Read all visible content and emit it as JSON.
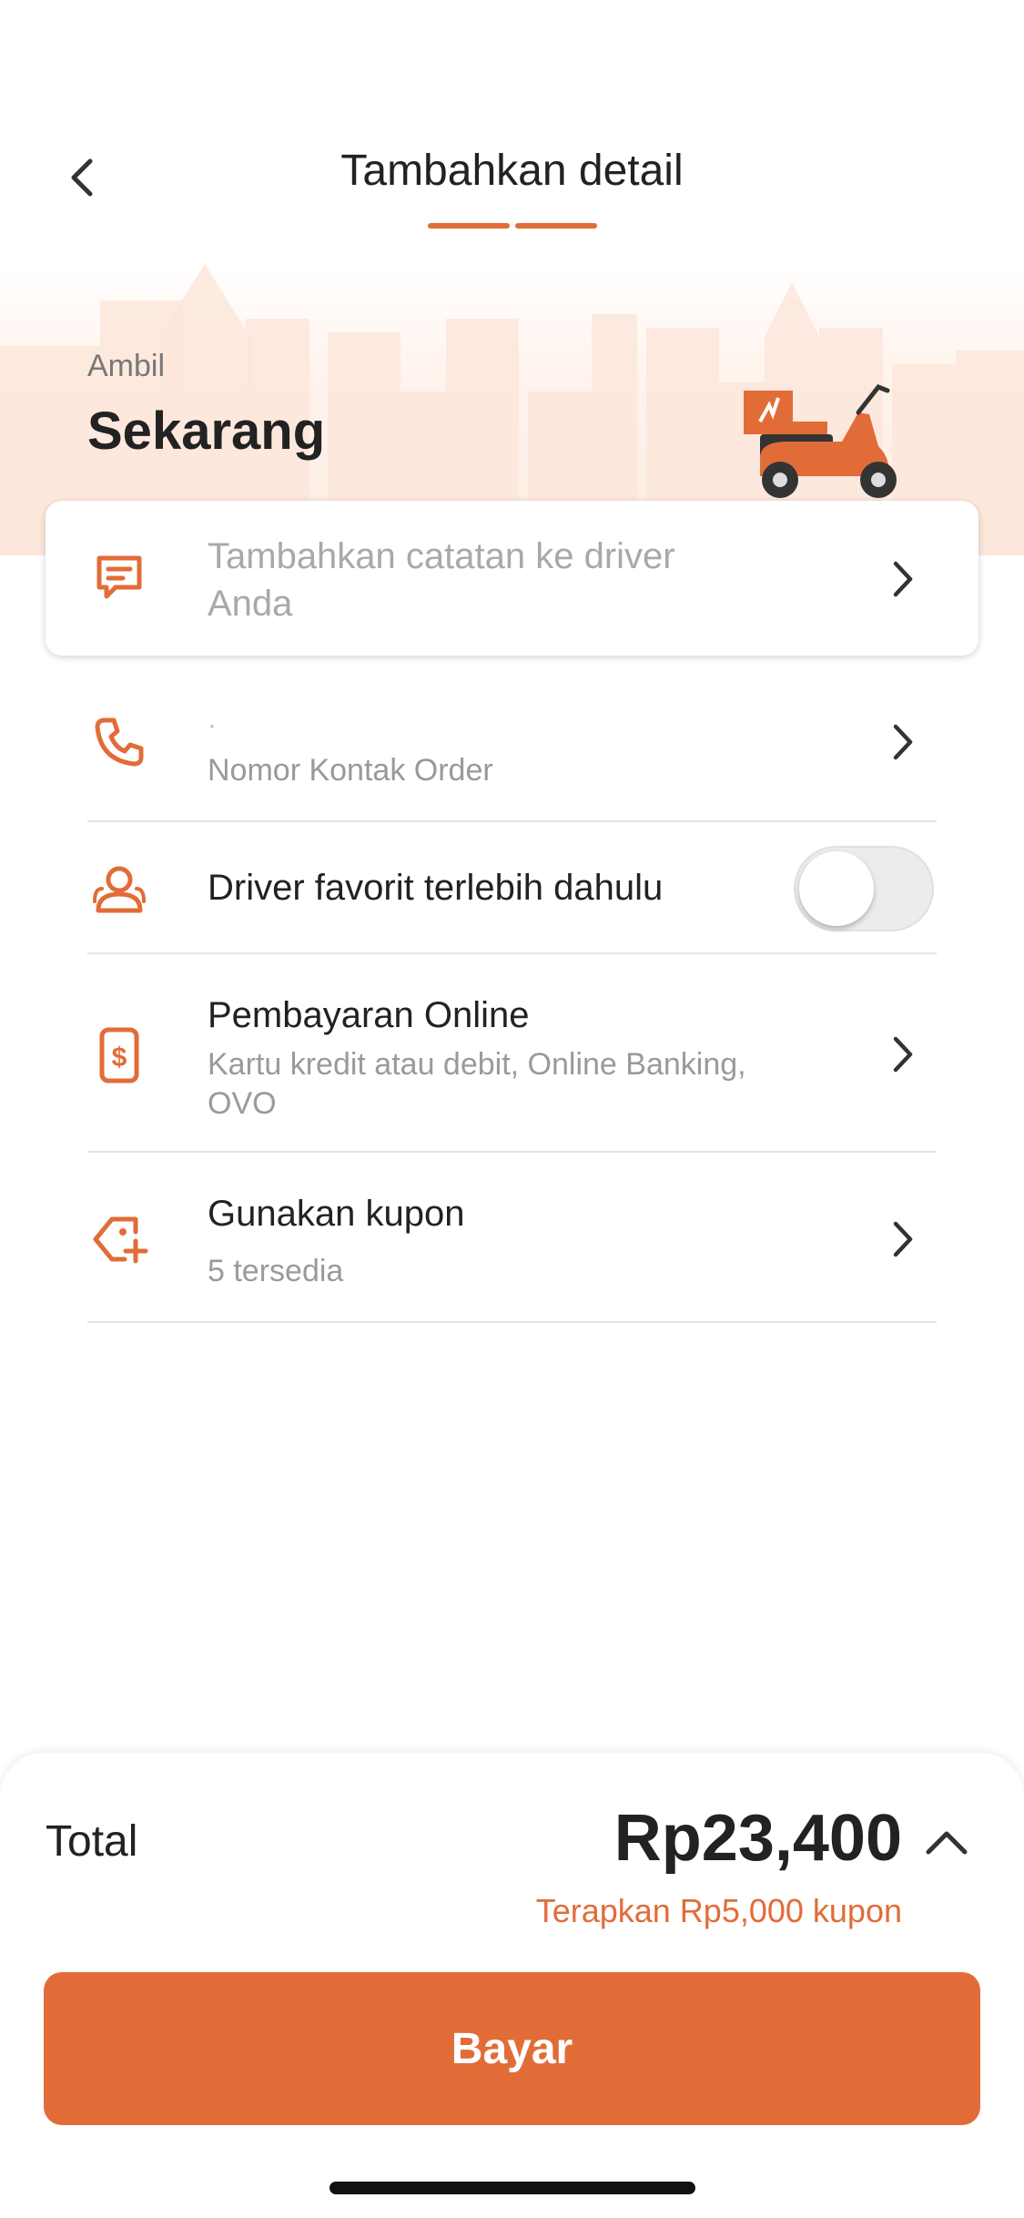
{
  "header": {
    "title": "Tambahkan detail",
    "step_count": 2,
    "accent_color": "#E26C38"
  },
  "pickup": {
    "label": "Ambil",
    "time": "Sekarang"
  },
  "note": {
    "placeholder": "Tambahkan catatan ke driver Anda",
    "icon": "message-icon"
  },
  "contact": {
    "value": "·",
    "label": "Nomor Kontak Order",
    "icon": "phone-icon"
  },
  "favorite_driver": {
    "label": "Driver favorit terlebih dahulu",
    "enabled": false,
    "icon": "users-icon"
  },
  "payment": {
    "title": "Pembayaran Online",
    "subtitle": "Kartu kredit atau debit, Online Banking, OVO",
    "icon": "payment-phone-icon"
  },
  "coupon": {
    "title": "Gunakan kupon",
    "subtitle": "5 tersedia",
    "icon": "coupon-tag-icon"
  },
  "summary": {
    "total_label": "Total",
    "total_amount": "Rp23,400",
    "coupon_apply": "Terapkan Rp5,000 kupon"
  },
  "actions": {
    "pay_label": "Bayar"
  }
}
